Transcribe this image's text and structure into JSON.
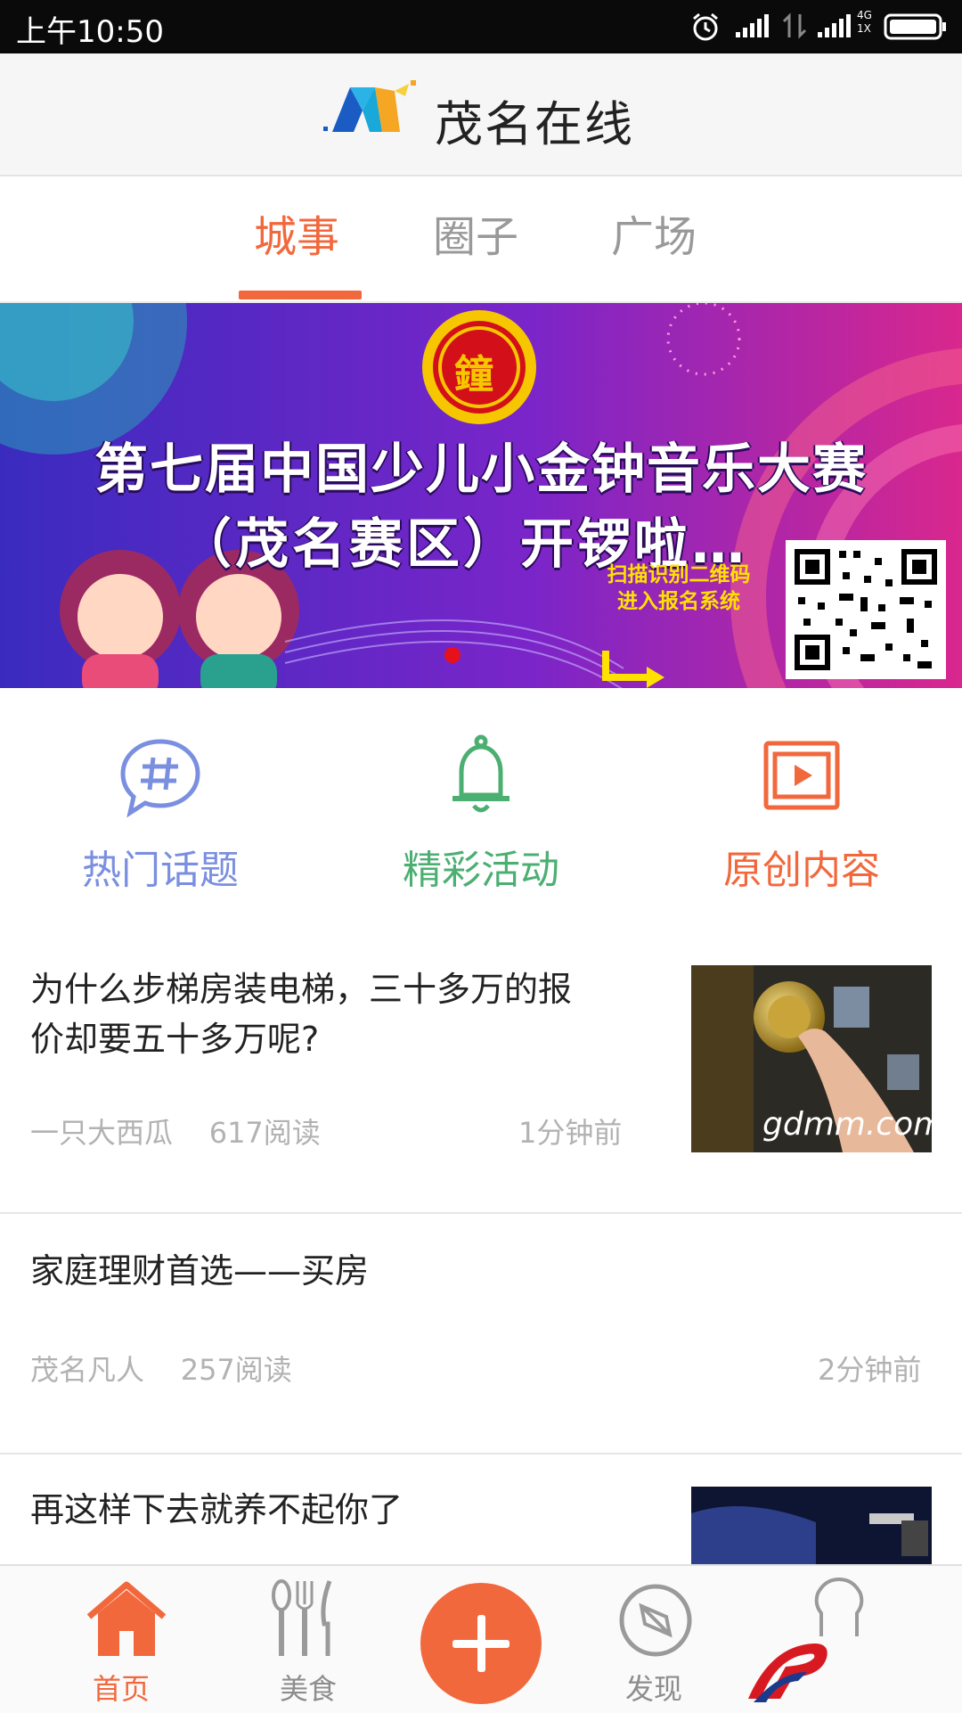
{
  "status_bar": {
    "time": "上午10:50",
    "network": [
      "4G",
      "1X"
    ]
  },
  "header": {
    "title": "茂名在线"
  },
  "tabs": [
    {
      "label": "城事",
      "active": true
    },
    {
      "label": "圈子",
      "active": false
    },
    {
      "label": "广场",
      "active": false
    }
  ],
  "banner": {
    "line1": "第七届中国少儿小金钟音乐大赛",
    "line2": "（茂名赛区）开锣啦…",
    "qr_caption_1": "扫描识别二维码",
    "qr_caption_2": "进入报名系统",
    "badge_glyph": "鐘"
  },
  "quick_entries": [
    {
      "label": "热门话题",
      "icon": "hashtag-chat-icon",
      "color": "#7b8fe0"
    },
    {
      "label": "精彩活动",
      "icon": "bell-icon",
      "color": "#4caf72"
    },
    {
      "label": "原创内容",
      "icon": "play-video-icon",
      "color": "#f2683d"
    }
  ],
  "articles": [
    {
      "title_line1": "为什么步梯房装电梯，三十多万的报",
      "title_line2": "价却要五十多万呢?",
      "author": "一只大西瓜",
      "reads": "617阅读",
      "time": "1分钟前",
      "thumb_watermark": "gdmm.com"
    },
    {
      "title_line1": "家庭理财首选——买房",
      "author": "茂名凡人",
      "reads": "257阅读",
      "time": "2分钟前"
    },
    {
      "title_line1": "再这样下去就养不起你了"
    }
  ],
  "bottom_nav": [
    {
      "label": "首页",
      "icon": "home-icon",
      "active": true
    },
    {
      "label": "美食",
      "icon": "cutlery-icon",
      "active": false
    },
    {
      "label": "",
      "icon": "plus-icon",
      "active": false
    },
    {
      "label": "发现",
      "icon": "compass-icon",
      "active": false
    },
    {
      "label": "",
      "icon": "profile-icon",
      "active": false
    }
  ],
  "colors": {
    "accent": "#f2683d",
    "hot": "#7b8fe0",
    "activity": "#4caf72",
    "muted": "#b2b2b2"
  }
}
